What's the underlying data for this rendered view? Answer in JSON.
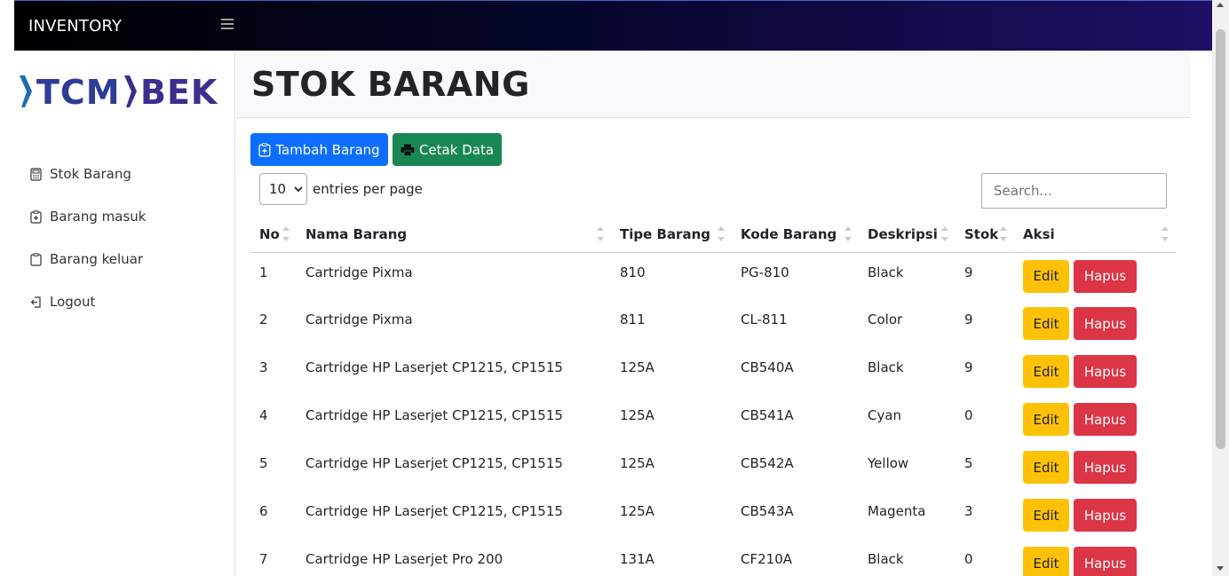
{
  "topbar": {
    "brand": "INVENTORY",
    "menu_icon": "hamburger-icon"
  },
  "logo": {
    "part1": "TCM",
    "part2": "BEK",
    "colors": {
      "left_mark": "#1f6fae",
      "right_mark": "#3a2f8d"
    }
  },
  "sidebar": {
    "items": [
      {
        "label": "Stok Barang",
        "icon": "calculator-icon"
      },
      {
        "label": "Barang masuk",
        "icon": "clipboard-plus-icon"
      },
      {
        "label": "Barang keluar",
        "icon": "clipboard-icon"
      },
      {
        "label": "Logout",
        "icon": "logout-icon"
      }
    ]
  },
  "page": {
    "title": "STOK BARANG"
  },
  "toolbar": {
    "add_label": "Tambah Barang",
    "print_label": "Cetak Data"
  },
  "table_controls": {
    "entries_value": "10",
    "entries_label": "entries per page",
    "search_placeholder": "Search..."
  },
  "table": {
    "headers": [
      "No",
      "Nama Barang",
      "Tipe Barang",
      "Kode Barang",
      "Deskripsi",
      "Stok",
      "Aksi"
    ],
    "rows": [
      {
        "no": "1",
        "nama": "Cartridge Pixma",
        "tipe": "810",
        "kode": "PG-810",
        "deskripsi": "Black",
        "stok": "9"
      },
      {
        "no": "2",
        "nama": "Cartridge Pixma",
        "tipe": "811",
        "kode": "CL-811",
        "deskripsi": "Color",
        "stok": "9"
      },
      {
        "no": "3",
        "nama": "Cartridge HP Laserjet CP1215, CP1515",
        "tipe": "125A",
        "kode": "CB540A",
        "deskripsi": "Black",
        "stok": "9"
      },
      {
        "no": "4",
        "nama": "Cartridge HP Laserjet CP1215, CP1515",
        "tipe": "125A",
        "kode": "CB541A",
        "deskripsi": "Cyan",
        "stok": "0"
      },
      {
        "no": "5",
        "nama": "Cartridge HP Laserjet CP1215, CP1515",
        "tipe": "125A",
        "kode": "CB542A",
        "deskripsi": "Yellow",
        "stok": "5"
      },
      {
        "no": "6",
        "nama": "Cartridge HP Laserjet CP1215, CP1515",
        "tipe": "125A",
        "kode": "CB543A",
        "deskripsi": "Magenta",
        "stok": "3"
      },
      {
        "no": "7",
        "nama": "Cartridge HP Laserjet Pro 200",
        "tipe": "131A",
        "kode": "CF210A",
        "deskripsi": "Black",
        "stok": "0"
      }
    ],
    "edit_label": "Edit",
    "delete_label": "Hapus"
  },
  "colors": {
    "primary": "#0d6efd",
    "success": "#198754",
    "warning": "#ffc107",
    "danger": "#dc3545"
  }
}
